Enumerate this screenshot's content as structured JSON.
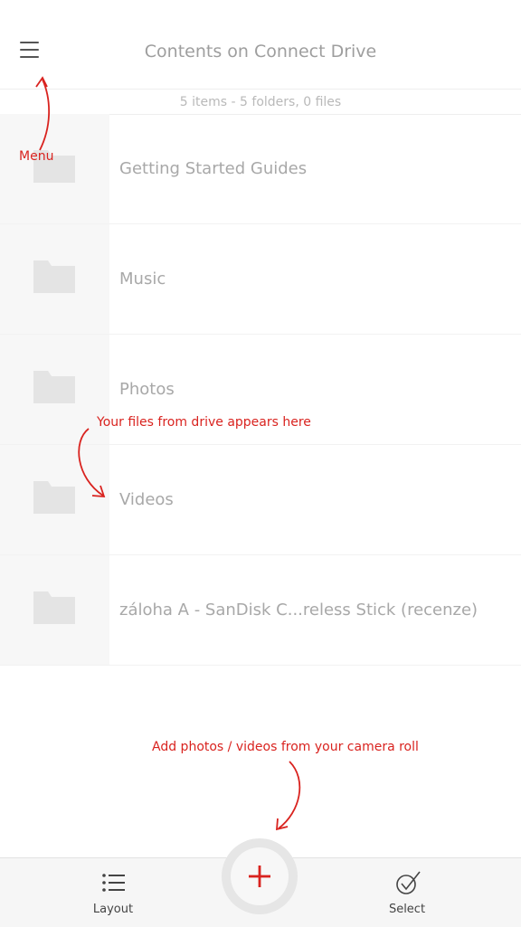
{
  "header": {
    "title": "Contents on Connect Drive",
    "menu_icon": "hamburger-icon"
  },
  "summary": "5 items - 5 folders, 0 files",
  "folders": [
    {
      "name": "Getting Started Guides",
      "icon": "folder-icon"
    },
    {
      "name": "Music",
      "icon": "folder-icon"
    },
    {
      "name": "Photos",
      "icon": "folder-icon"
    },
    {
      "name": "Videos",
      "icon": "folder-icon"
    },
    {
      "name": "záloha A - SanDisk C...reless Stick (recenze)",
      "icon": "folder-icon"
    }
  ],
  "annotations": {
    "menu": "Menu",
    "files": "Your files from drive appears here",
    "add": "Add photos / videos from your camera roll"
  },
  "toolbar": {
    "layout_label": "Layout",
    "layout_icon": "list-icon",
    "add_icon": "plus-icon",
    "select_label": "Select",
    "select_icon": "check-circle-icon"
  },
  "colors": {
    "accent": "#d9231f",
    "text_muted": "#a8a8a8",
    "folder": "#e4e4e4"
  }
}
